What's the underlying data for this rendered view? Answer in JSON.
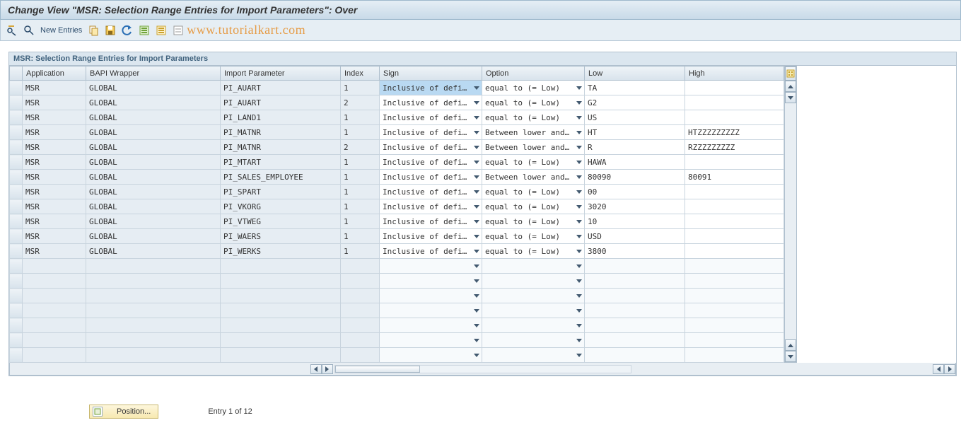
{
  "title": "Change View \"MSR: Selection Range Entries for Import Parameters\": Over",
  "toolbar": {
    "new_entries": "New Entries",
    "watermark": "www.tutorialkart.com"
  },
  "panel": {
    "header": "MSR: Selection Range Entries for Import Parameters"
  },
  "columns": {
    "application": "Application",
    "bapi_wrapper": "BAPI Wrapper",
    "import_parameter": "Import Parameter",
    "index": "Index",
    "sign": "Sign",
    "option": "Option",
    "low": "Low",
    "high": "High"
  },
  "col_widths": {
    "rowsel": 18,
    "application": 90,
    "bapi_wrapper": 190,
    "import_parameter": 170,
    "index": 55,
    "sign": 145,
    "option": 145,
    "low": 142,
    "high": 140
  },
  "rows": [
    {
      "application": "MSR",
      "bapi_wrapper": "GLOBAL",
      "import_parameter": "PI_AUART",
      "index": "1",
      "sign": "Inclusive of defi…",
      "option": "equal to (= Low)",
      "low": "TA",
      "high": "",
      "highlight": true
    },
    {
      "application": "MSR",
      "bapi_wrapper": "GLOBAL",
      "import_parameter": "PI_AUART",
      "index": "2",
      "sign": "Inclusive of defi…",
      "option": "equal to (= Low)",
      "low": "G2",
      "high": ""
    },
    {
      "application": "MSR",
      "bapi_wrapper": "GLOBAL",
      "import_parameter": "PI_LAND1",
      "index": "1",
      "sign": "Inclusive of defi…",
      "option": "equal to (= Low)",
      "low": "US",
      "high": ""
    },
    {
      "application": "MSR",
      "bapi_wrapper": "GLOBAL",
      "import_parameter": "PI_MATNR",
      "index": "1",
      "sign": "Inclusive of defi…",
      "option": "Between lower and…",
      "low": "HT",
      "high": "HTZZZZZZZZZ"
    },
    {
      "application": "MSR",
      "bapi_wrapper": "GLOBAL",
      "import_parameter": "PI_MATNR",
      "index": "2",
      "sign": "Inclusive of defi…",
      "option": "Between lower and…",
      "low": "R",
      "high": "RZZZZZZZZZ"
    },
    {
      "application": "MSR",
      "bapi_wrapper": "GLOBAL",
      "import_parameter": "PI_MTART",
      "index": "1",
      "sign": "Inclusive of defi…",
      "option": "equal to (= Low)",
      "low": "HAWA",
      "high": ""
    },
    {
      "application": "MSR",
      "bapi_wrapper": "GLOBAL",
      "import_parameter": "PI_SALES_EMPLOYEE",
      "index": "1",
      "sign": "Inclusive of defi…",
      "option": "Between lower and…",
      "low": "80090",
      "high": "80091"
    },
    {
      "application": "MSR",
      "bapi_wrapper": "GLOBAL",
      "import_parameter": "PI_SPART",
      "index": "1",
      "sign": "Inclusive of defi…",
      "option": "equal to (= Low)",
      "low": "00",
      "high": ""
    },
    {
      "application": "MSR",
      "bapi_wrapper": "GLOBAL",
      "import_parameter": "PI_VKORG",
      "index": "1",
      "sign": "Inclusive of defi…",
      "option": "equal to (= Low)",
      "low": "3020",
      "high": ""
    },
    {
      "application": "MSR",
      "bapi_wrapper": "GLOBAL",
      "import_parameter": "PI_VTWEG",
      "index": "1",
      "sign": "Inclusive of defi…",
      "option": "equal to (= Low)",
      "low": "10",
      "high": ""
    },
    {
      "application": "MSR",
      "bapi_wrapper": "GLOBAL",
      "import_parameter": "PI_WAERS",
      "index": "1",
      "sign": "Inclusive of defi…",
      "option": "equal to (= Low)",
      "low": "USD",
      "high": ""
    },
    {
      "application": "MSR",
      "bapi_wrapper": "GLOBAL",
      "import_parameter": "PI_WERKS",
      "index": "1",
      "sign": "Inclusive of defi…",
      "option": "equal to (= Low)",
      "low": "3800",
      "high": ""
    }
  ],
  "empty_rows": 7,
  "footer": {
    "position_label": "Position...",
    "entry_text": "Entry 1 of 12"
  }
}
